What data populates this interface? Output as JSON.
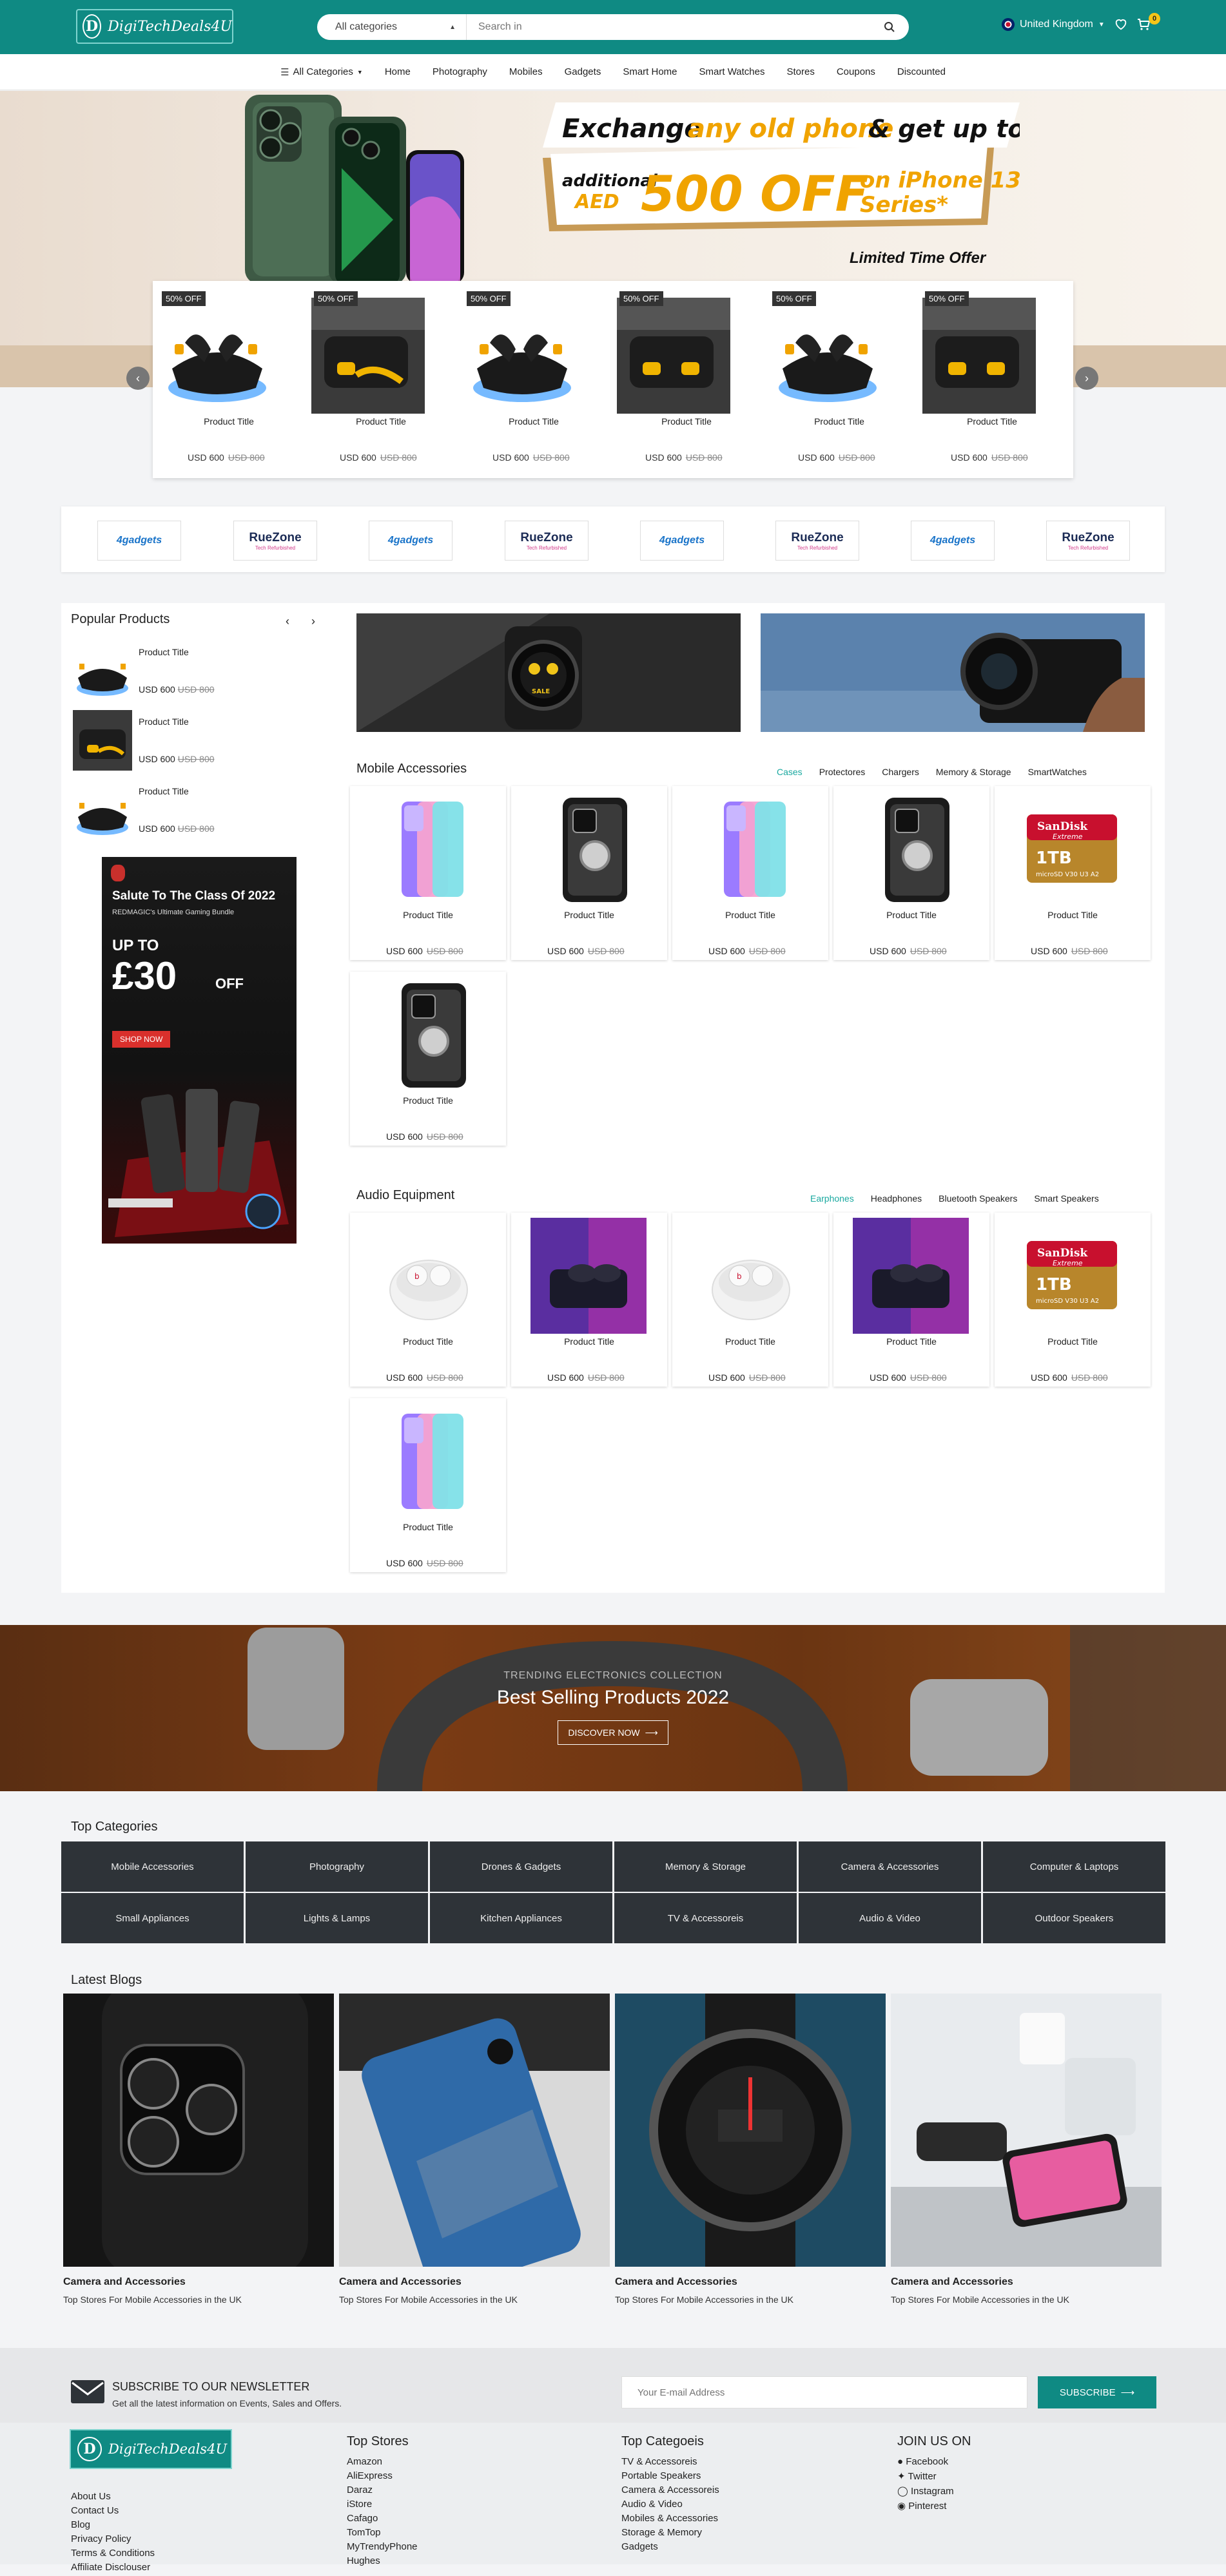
{
  "header": {
    "logo_text": "DigiTechDeals4U",
    "category_select": "All categories",
    "search_placeholder": "Search in",
    "country": "United Kingdom",
    "cart_count": "0"
  },
  "nav": {
    "all_categories": "All Categories",
    "items": [
      "Home",
      "Photography",
      "Mobiles",
      "Gadgets",
      "Smart Home",
      "Smart Watches",
      "Stores",
      "Coupons",
      "Discounted"
    ]
  },
  "hero": {
    "line1a": "Exchange",
    "line1b": "any old phone",
    "line1c": "& get up to",
    "line2a": "additional",
    "line2b": "AED",
    "line2c": "500 OFF",
    "line2d": "on iPhone 13",
    "line2e": "Series*",
    "limited": "Limited Time Offer"
  },
  "deals": [
    {
      "badge": "50% OFF",
      "title": "Product Title",
      "price": "USD 600",
      "old": "USD 800"
    },
    {
      "badge": "50% OFF",
      "title": "Product Title",
      "price": "USD 600",
      "old": "USD 800"
    },
    {
      "badge": "50% OFF",
      "title": "Product Title",
      "price": "USD 600",
      "old": "USD 800"
    },
    {
      "badge": "50% OFF",
      "title": "Product Title",
      "price": "USD 600",
      "old": "USD 800"
    },
    {
      "badge": "50% OFF",
      "title": "Product Title",
      "price": "USD 600",
      "old": "USD 800"
    },
    {
      "badge": "50% OFF",
      "title": "Product Title",
      "price": "USD 600",
      "old": "USD 800"
    }
  ],
  "brands": [
    "4gadgets",
    "RueZone",
    "4gadgets",
    "RueZone",
    "4gadgets",
    "RueZone",
    "4gadgets",
    "RueZone"
  ],
  "brand_tag": "Tech Refurbished",
  "popular": {
    "title": "Popular Products",
    "items": [
      {
        "title": "Product Title",
        "price": "USD 600",
        "old": "USD 800"
      },
      {
        "title": "Product Title",
        "price": "USD 600",
        "old": "USD 800"
      },
      {
        "title": "Product Title",
        "price": "USD 600",
        "old": "USD 800"
      }
    ]
  },
  "promo": {
    "title": "Salute To The Class Of 2022",
    "sub": "REDMAGIC's Ultimate Gaming Bundle",
    "upto": "UP TO",
    "amount": "£30",
    "off": "OFF",
    "cta": "SHOP NOW"
  },
  "mobile_accessories": {
    "title": "Mobile Accessories",
    "tabs": [
      "Cases",
      "Protectores",
      "Chargers",
      "Memory & Storage",
      "SmartWatches"
    ],
    "products": [
      {
        "title": "Product Title",
        "price": "USD 600",
        "old": "USD 800",
        "img": "gradient-case"
      },
      {
        "title": "Product Title",
        "price": "USD 600",
        "old": "USD 800",
        "img": "armor-case"
      },
      {
        "title": "Product Title",
        "price": "USD 600",
        "old": "USD 800",
        "img": "gradient-case"
      },
      {
        "title": "Product Title",
        "price": "USD 600",
        "old": "USD 800",
        "img": "armor-case"
      },
      {
        "title": "Product Title",
        "price": "USD 600",
        "old": "USD 800",
        "img": "sd-card"
      },
      {
        "title": "Product Title",
        "price": "USD 600",
        "old": "USD 800",
        "img": "armor-case"
      }
    ]
  },
  "audio_equipment": {
    "title": "Audio Equipment",
    "tabs": [
      "Earphones",
      "Headphones",
      "Bluetooth Speakers",
      "Smart Speakers"
    ],
    "products": [
      {
        "title": "Product Title",
        "price": "USD 600",
        "old": "USD 800",
        "img": "earbuds-white"
      },
      {
        "title": "Product Title",
        "price": "USD 600",
        "old": "USD 800",
        "img": "earbuds-purple"
      },
      {
        "title": "Product Title",
        "price": "USD 600",
        "old": "USD 800",
        "img": "earbuds-white"
      },
      {
        "title": "Product Title",
        "price": "USD 600",
        "old": "USD 800",
        "img": "earbuds-purple"
      },
      {
        "title": "Product Title",
        "price": "USD 600",
        "old": "USD 800",
        "img": "sd-card"
      },
      {
        "title": "Product Title",
        "price": "USD 600",
        "old": "USD 800",
        "img": "gradient-case"
      }
    ]
  },
  "sd_card": {
    "brand": "SanDisk",
    "line": "Extreme",
    "size": "1TB",
    "tags": "microSD V30 U3 A2"
  },
  "watch_label": "SALE",
  "best_selling": {
    "kicker": "TRENDING ELECTRONICS COLLECTION",
    "title": "Best Selling Products 2022",
    "cta": "DISCOVER NOW"
  },
  "top_categories": {
    "title": "Top Categories",
    "items": [
      "Mobile Accessories",
      "Photography",
      "Drones & Gadgets",
      "Memory & Storage",
      "Camera & Accessories",
      "Computer & Laptops",
      "Small Appliances",
      "Lights & Lamps",
      "Kitchen Appliances",
      "TV & Accessoreis",
      "Audio & Video",
      "Outdoor Speakers"
    ]
  },
  "blogs": {
    "title": "Latest Blogs",
    "items": [
      {
        "cat": "Camera and Accessories",
        "title": "Top Stores For Mobile Accessories in the UK"
      },
      {
        "cat": "Camera and Accessories",
        "title": "Top Stores For Mobile Accessories in the UK"
      },
      {
        "cat": "Camera and Accessories",
        "title": "Top Stores For Mobile Accessories in the UK"
      },
      {
        "cat": "Camera and Accessories",
        "title": "Top Stores For Mobile Accessories in the UK"
      }
    ]
  },
  "newsletter": {
    "title": "SUBSCRIBE TO OUR NEWSLETTER",
    "sub": "Get all the latest information on Events, Sales and Offers.",
    "placeholder": "Your E-mail Address",
    "button": "SUBSCRIBE"
  },
  "footer": {
    "links": [
      "About Us",
      "Contact Us",
      "Blog",
      "Privacy Policy",
      "Terms & Conditions",
      "Affiliate Disclouser"
    ],
    "stores_title": "Top Stores",
    "stores": [
      "Amazon",
      "AliExpress",
      "Daraz",
      "iStore",
      "Cafago",
      "TomTop",
      "MyTrendyPhone",
      "Hughes"
    ],
    "cats_title": "Top Categoeis",
    "cats": [
      "TV & Accessoreis",
      "Portable Speakers",
      "Camera & Accessoreis",
      "Audio & Video",
      "Mobiles & Accessories",
      "Storage & Memory",
      "Gadgets"
    ],
    "social_title": "JOIN US ON",
    "social": [
      "Facebook",
      "Twitter",
      "Instagram",
      "Pinterest"
    ]
  }
}
